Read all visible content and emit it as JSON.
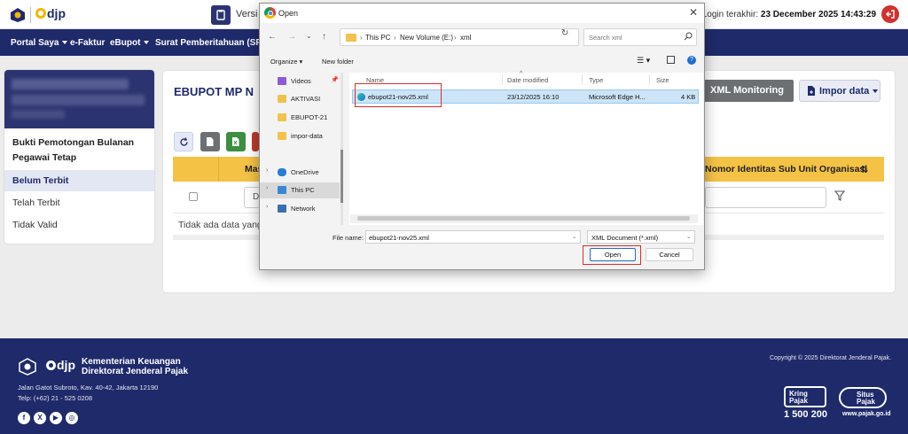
{
  "app": {
    "logo_text": "djp",
    "version_label": "Versi",
    "login_label": "Login terakhir:",
    "login_time": "23 December 2025 14:43:29"
  },
  "nav": {
    "items": [
      {
        "label": "Portal Saya",
        "caret": true
      },
      {
        "label": "e-Faktur",
        "caret": false
      },
      {
        "label": "eBupot",
        "caret": true
      },
      {
        "label": "Surat Pemberitahuan (SPT)",
        "caret": false
      }
    ]
  },
  "sidebar": {
    "title": "Bukti Pemotongan Bulanan Pegawai Tetap",
    "items": [
      {
        "label": "Belum Terbit",
        "active": true
      },
      {
        "label": "Telah Terbit",
        "active": false
      },
      {
        "label": "Tidak Valid",
        "active": false
      }
    ]
  },
  "main": {
    "page_title": "EBUPOT MP N",
    "xml_monitoring": "XML Monitoring",
    "impor_data": "Impor data",
    "col_masa": "Mas",
    "col_nomor": "Nomor Identitas Sub Unit Organisasi",
    "filter_prefix": "D",
    "empty_text": "Tidak ada data yang"
  },
  "footer": {
    "org_line1": "Kementerian Keuangan",
    "org_line2": "Direktorat Jenderal Pajak",
    "address": "Jalan Gatot Subroto, Kav. 40-42, Jakarta 12190",
    "telp": "Telp: (+62) 21 - 525 0208",
    "copyright": "Copyright © 2025 Direktorat Jenderal Pajak.",
    "kring_line1": "Kring",
    "kring_line2": "Pajak",
    "kring_number": "1 500 200",
    "situs_line1": "Situs",
    "situs_line2": "Pajak",
    "situs_url": "www.pajak.go.id",
    "social": [
      "f",
      "X",
      "▶",
      "◎"
    ]
  },
  "dialog": {
    "title": "Open",
    "breadcrumb": [
      "This PC",
      "New Volume (E:)",
      "xml"
    ],
    "search_placeholder": "Search xml",
    "organize_label": "Organize",
    "new_folder_label": "New folder",
    "nav_items": [
      {
        "label": "Videos",
        "icon_color": "#8e5bd6",
        "pinned": true,
        "expander": ""
      },
      {
        "label": "AKTIVASI",
        "icon_color": "#f1c24f",
        "pinned": false,
        "expander": ""
      },
      {
        "label": "EBUPOT-21",
        "icon_color": "#f1c24f",
        "pinned": false,
        "expander": ""
      },
      {
        "label": "impor-data",
        "icon_color": "#f1c24f",
        "pinned": false,
        "expander": ""
      },
      {
        "label": "OneDrive",
        "icon_color": "#2b7cd3",
        "pinned": false,
        "expander": ">"
      },
      {
        "label": "This PC",
        "icon_color": "#3a86d4",
        "pinned": false,
        "expander": ">"
      },
      {
        "label": "Network",
        "icon_color": "#3a6fb0",
        "pinned": false,
        "expander": ">"
      }
    ],
    "columns": {
      "name": "Name",
      "date": "Date modified",
      "type": "Type",
      "size": "Size"
    },
    "file": {
      "name": "ebupot21-nov25.xml",
      "date": "23/12/2025 16:10",
      "type": "Microsoft Edge H...",
      "size": "4 KB"
    },
    "file_name_label": "File name:",
    "file_name_value": "ebupot21-nov25.xml",
    "file_type_value": "XML Document (*.xml)",
    "open_label": "Open",
    "cancel_label": "Cancel"
  },
  "colors": {
    "navy": "#1f2a6b",
    "table_header": "#f4c245",
    "highlight_red": "#e02b2b",
    "selection": "#cce4f7"
  }
}
